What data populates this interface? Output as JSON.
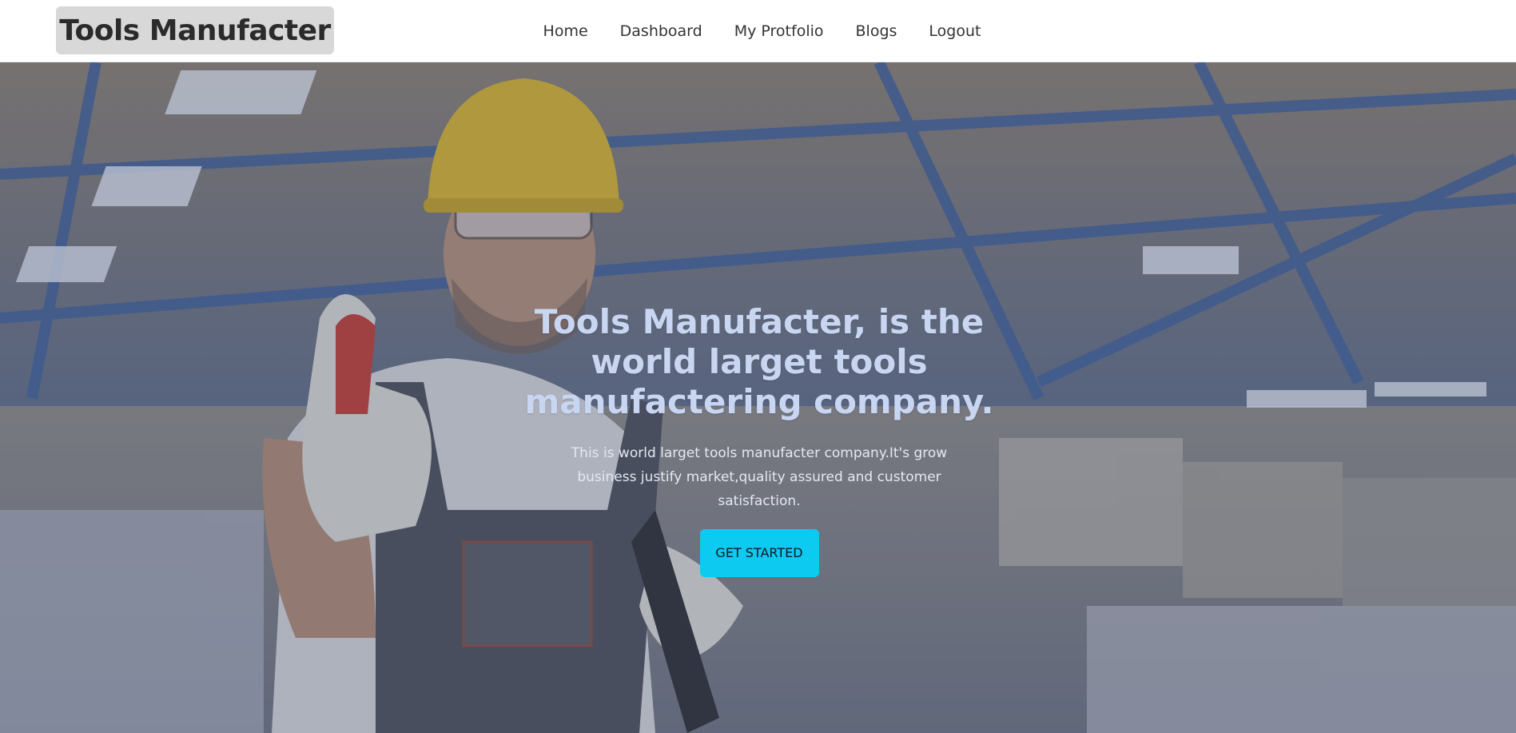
{
  "navbar": {
    "brand": "Tools Manufacter",
    "links": [
      {
        "label": "Home"
      },
      {
        "label": "Dashboard"
      },
      {
        "label": "My Protfolio"
      },
      {
        "label": "Blogs"
      },
      {
        "label": "Logout"
      }
    ]
  },
  "hero": {
    "title": "Tools Manufacter, is the world larget tools manufactering company.",
    "subtitle": "This is world larget tools manufacter company.It's grow business justify market,quality assured and customer satisfaction.",
    "cta_label": "GET STARTED",
    "background_image": "factory-worker-thumbs-up-photo"
  },
  "colors": {
    "cta": "#0dcaf0",
    "title": "#c9d6f2",
    "brand_bg": "#d8d8d8"
  }
}
